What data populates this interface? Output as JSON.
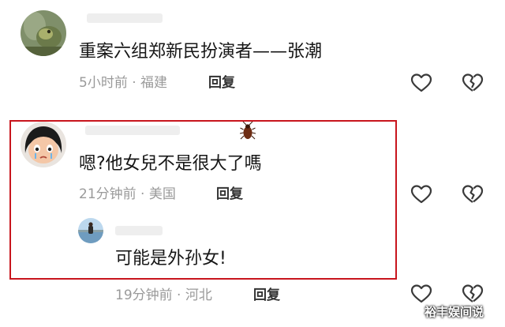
{
  "comments": [
    {
      "avatar_icon": "frog-photo-avatar",
      "text": "重案六组郑新民扮演者——张潮",
      "time": "5小时前",
      "separator": "·",
      "location": "福建",
      "reply_label": "回复",
      "like_icon": "heart-outline-icon",
      "dislike_icon": "broken-heart-icon"
    },
    {
      "avatar_icon": "crying-doll-avatar",
      "sticker_icon": "cockroach-sticker-icon",
      "text": "嗯?他女兒不是很大了嗎",
      "time": "21分钟前",
      "separator": "·",
      "location": "美国",
      "reply_label": "回复",
      "like_icon": "heart-outline-icon",
      "dislike_icon": "broken-heart-icon",
      "reply": {
        "avatar_icon": "lakeside-photo-avatar",
        "text": "可能是外孙女!",
        "time": "19分钟前",
        "separator": "·",
        "location": "河北",
        "reply_label": "回复",
        "like_icon": "heart-outline-icon",
        "dislike_icon": "broken-heart-icon"
      }
    }
  ],
  "watermark": "裕丰娱间说",
  "colors": {
    "highlight_border": "#c8151d",
    "meta_text": "#9a9a9a",
    "body_text": "#161616",
    "icon_stroke": "#3a3a3a"
  }
}
